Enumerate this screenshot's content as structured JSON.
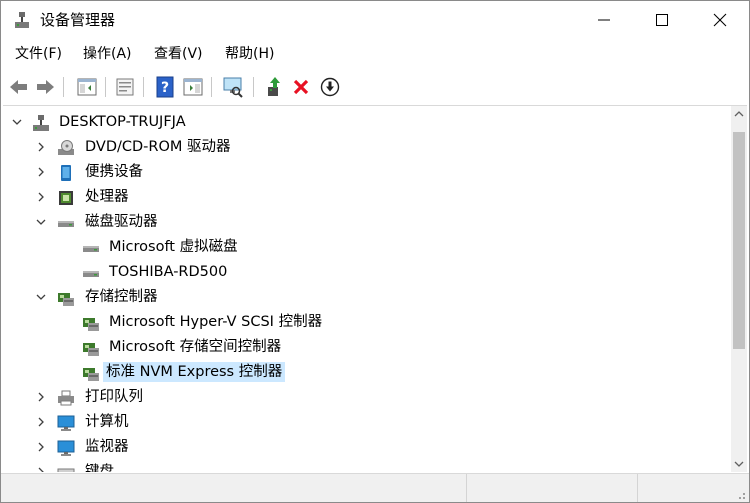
{
  "window": {
    "title": "设备管理器"
  },
  "menu": [
    {
      "label": "文件(F)"
    },
    {
      "label": "操作(A)"
    },
    {
      "label": "查看(V)"
    },
    {
      "label": "帮助(H)"
    }
  ],
  "toolbar": {
    "icons": [
      "back-arrow-icon",
      "forward-arrow-icon",
      "show-hide-console-tree-icon",
      "properties-icon",
      "help-icon",
      "action-pane-icon",
      "scan-hardware-changes-icon",
      "update-driver-icon",
      "uninstall-device-icon",
      "disable-device-icon"
    ]
  },
  "tree": {
    "root": "DESKTOP-TRUJFJA",
    "items": [
      {
        "label": "DVD/CD-ROM 驱动器"
      },
      {
        "label": "便携设备"
      },
      {
        "label": "处理器"
      },
      {
        "label": "磁盘驱动器"
      },
      {
        "label": "Microsoft 虚拟磁盘"
      },
      {
        "label": "TOSHIBA-RD500"
      },
      {
        "label": "存储控制器"
      },
      {
        "label": "Microsoft Hyper-V SCSI 控制器"
      },
      {
        "label": "Microsoft 存储空间控制器"
      },
      {
        "label": "标准 NVM Express 控制器"
      },
      {
        "label": "打印队列"
      },
      {
        "label": "计算机"
      },
      {
        "label": "监视器"
      },
      {
        "label": "键盘"
      }
    ]
  },
  "colors": {
    "selection": "#cce8ff",
    "delete_red": "#e81123",
    "monitor_blue": "#2a8fd8"
  }
}
